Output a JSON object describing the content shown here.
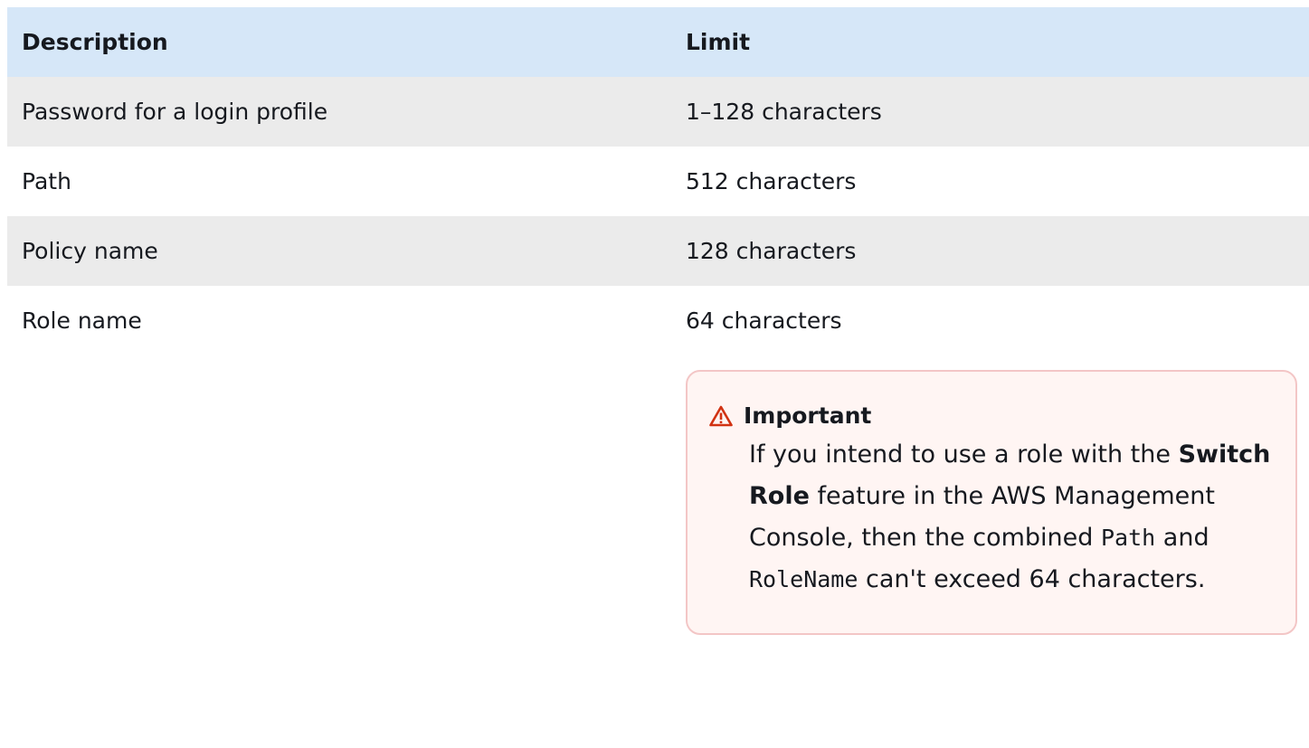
{
  "table": {
    "headers": {
      "description": "Description",
      "limit": "Limit"
    },
    "rows": [
      {
        "description": "Password for a login profile",
        "limit": "1–128 characters"
      },
      {
        "description": "Path",
        "limit": "512 characters"
      },
      {
        "description": "Policy name",
        "limit": "128 characters"
      },
      {
        "description": "Role name",
        "limit": "64 characters"
      }
    ]
  },
  "callout": {
    "icon": "warning-icon",
    "color": "#d13212",
    "title": "Important",
    "text_1": "If you intend to use a role with the ",
    "bold_1": "Switch Role",
    "text_2": " feature in the AWS Management Console, then the combined ",
    "code_1": "Path",
    "text_3": " and ",
    "code_2": "RoleName",
    "text_4": " can't exceed 64 characters."
  }
}
